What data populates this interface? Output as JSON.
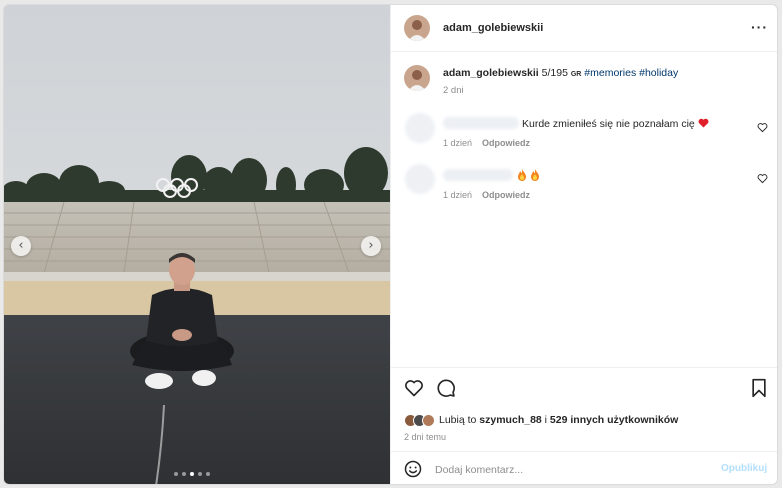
{
  "post": {
    "username": "adam_golebiewskii",
    "caption": {
      "username": "adam_golebiewskii",
      "text": " 5/195 ",
      "flag_label": "GR",
      "hashtags": [
        "#memories",
        "#holiday"
      ],
      "time": "2 dni"
    },
    "photo": {
      "carousel_total": 5,
      "carousel_active": 3
    }
  },
  "comments": [
    {
      "text": "Kurde zmieniłeś się nie poznałam cię",
      "emoji": "heart",
      "time": "1 dzień",
      "reply_label": "Odpowiedz"
    },
    {
      "text": "",
      "emoji": "fire-fire",
      "time": "1 dzień",
      "reply_label": "Odpowiedz"
    }
  ],
  "likes": {
    "prefix": "Lubią to ",
    "user": "szymuch_88",
    "middle": " i ",
    "others": "529 innych użytkowników"
  },
  "post_date": "2 dni temu",
  "comment_box": {
    "placeholder": "Dodaj komentarz...",
    "publish_label": "Opublikuj"
  },
  "colors": {
    "link": "#00376b",
    "muted": "#8e8e8e",
    "publish_disabled": "#b2dffc",
    "heart": "#e0202a"
  },
  "icons": [
    "more-icon",
    "heart-icon",
    "comment-icon",
    "bookmark-icon",
    "emoji-icon",
    "chevron-left-icon",
    "chevron-right-icon"
  ]
}
